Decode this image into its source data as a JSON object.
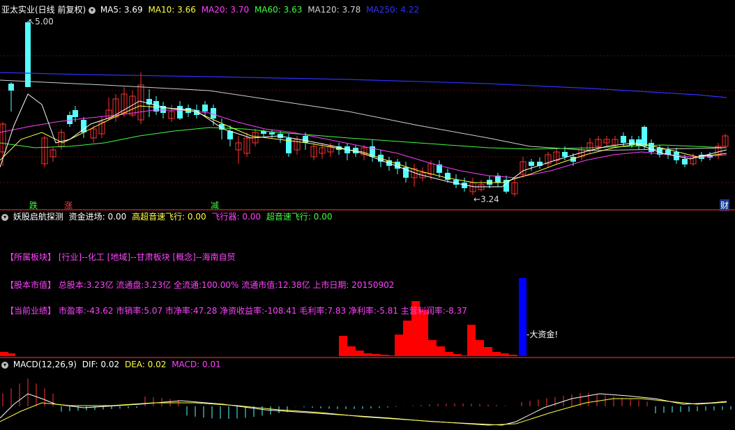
{
  "main_panel": {
    "stock_title": "亚太实业(日线 前复权)",
    "ma": [
      {
        "label": "MA5: 3.69",
        "color": "#ffffff"
      },
      {
        "label": "MA10: 3.66",
        "color": "#ffff40"
      },
      {
        "label": "MA20: 3.70",
        "color": "#ff40ff"
      },
      {
        "label": "MA60: 3.63",
        "color": "#40ff40"
      },
      {
        "label": "MA120: 3.78",
        "color": "#d0d0d0"
      },
      {
        "label": "MA250: 4.22",
        "color": "#3030ff"
      }
    ],
    "high_label": "5.00",
    "low_label": "3.24",
    "markers": {
      "die": "跌",
      "zhang": "涨",
      "jian": "减",
      "cai": "财"
    }
  },
  "indicator_panel": {
    "title": "妖股启航探测",
    "values": [
      {
        "label": "资金进场: 0.00",
        "color": "#ffffff"
      },
      {
        "label": "高超音速飞行: 0.00",
        "color": "#ffff40"
      },
      {
        "label": "飞行器: 0.00",
        "color": "#ff40ff"
      },
      {
        "label": "超音速飞行: 0.00",
        "color": "#40ff40"
      }
    ],
    "sector_line": "【所属板块】 [行业]--化工 [地域]--甘肃板块 [概念]--海南自贸",
    "equity_line": "【股本市值】 总股本:3.23亿 流通盘:3.23亿 全流通:100.00% 流通市值:12.38亿 上市日期: 20150902",
    "perf_line": "【当前业绩】 市盈率:-43.62 市销率:5.07 市净率:47.28 净资收益率:-108.41 毛利率:7.83 净利率:-5.81 主营利润率:-8.37",
    "big_fund_label": "-大资金!"
  },
  "macd_panel": {
    "title": "MACD(12,26,9)",
    "values": [
      {
        "label": "DIF: 0.02",
        "color": "#ffffff"
      },
      {
        "label": "DEA: 0.02",
        "color": "#ffff40"
      },
      {
        "label": "MACD: 0.01",
        "color": "#ff40ff"
      }
    ]
  },
  "colors": {
    "up": "#ff3232",
    "down": "#54ffff",
    "separator": "#8b1a1a",
    "volume_red": "#ff0000",
    "volume_blue": "#0000ff"
  }
}
